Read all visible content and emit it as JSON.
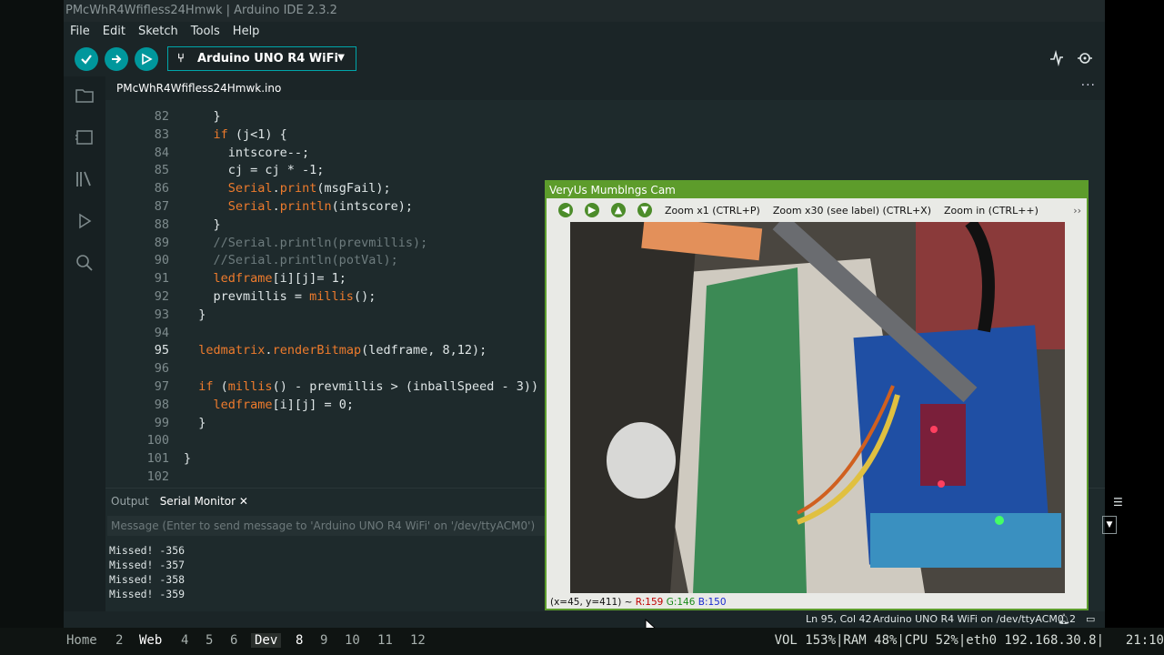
{
  "window": {
    "title": "PMcWhR4Wfifless24Hmwk | Arduino IDE 2.3.2"
  },
  "menu": [
    "File",
    "Edit",
    "Sketch",
    "Tools",
    "Help"
  ],
  "toolbar": {
    "board": "Arduino UNO R4 WiFi"
  },
  "tab": {
    "filename": "PMcWhR4Wfifless24Hmwk.ino",
    "more": "···"
  },
  "editor": {
    "lines": [
      {
        "n": "82",
        "html": "    }"
      },
      {
        "n": "83",
        "html": "    <span class=\"kw\">if</span> (j&lt;1) {"
      },
      {
        "n": "84",
        "html": "      intscore--;"
      },
      {
        "n": "85",
        "html": "      cj = cj * -1;"
      },
      {
        "n": "86",
        "html": "      <span class=\"kw\">Serial</span>.<span class=\"kw\">print</span>(msgFail);"
      },
      {
        "n": "87",
        "html": "      <span class=\"kw\">Serial</span>.<span class=\"kw\">println</span>(intscore);"
      },
      {
        "n": "88",
        "html": "    }"
      },
      {
        "n": "89",
        "html": "    <span class=\"cm\">//Serial.println(prevmillis);</span>"
      },
      {
        "n": "90",
        "html": "    <span class=\"cm\">//Serial.println(potVal);</span>"
      },
      {
        "n": "91",
        "html": "    <span class=\"kw\">ledframe</span>[i][j]= 1;"
      },
      {
        "n": "92",
        "html": "    prevmillis = <span class=\"kw\">millis</span>();"
      },
      {
        "n": "93",
        "html": "  }"
      },
      {
        "n": "94",
        "html": ""
      },
      {
        "n": "95",
        "html": "  <span class=\"kw\">ledmatrix</span>.<span class=\"kw\">renderBitmap</span>(ledframe, 8,12);"
      },
      {
        "n": "96",
        "html": ""
      },
      {
        "n": "97",
        "html": "  <span class=\"kw\">if</span> (<span class=\"kw\">millis</span>() - prevmillis &gt; (inballSpeed - 3))"
      },
      {
        "n": "98",
        "html": "    <span class=\"kw\">ledframe</span>[i][j] = 0;"
      },
      {
        "n": "99",
        "html": "  }"
      },
      {
        "n": "100",
        "html": ""
      },
      {
        "n": "101",
        "html": "}"
      },
      {
        "n": "102",
        "html": ""
      }
    ]
  },
  "panel": {
    "tabs": [
      "Output",
      "Serial Monitor"
    ],
    "input_placeholder": "Message (Enter to send message to 'Arduino UNO R4 WiFi' on '/dev/ttyACM0')",
    "serial": [
      "Missed! -356",
      "Missed! -357",
      "Missed! -358",
      "Missed! -359"
    ]
  },
  "status": {
    "position": "Ln 95, Col 42",
    "board": "Arduino UNO R4 WiFi on /dev/ttyACM0",
    "notif": "2"
  },
  "cam": {
    "title": "VeryUs Mumblngs Cam",
    "zoom1": "Zoom x1 (CTRL+P)",
    "zoom30": "Zoom x30 (see label) (CTRL+X)",
    "zoomin": "Zoom in (CTRL++)",
    "more": "››",
    "coord": "(x=45, y=411) ~ ",
    "r": "R:159",
    "g": "G:146",
    "b": "B:150"
  },
  "taskbar": {
    "workspaces": [
      "Home",
      "2",
      "Web",
      "4",
      "5",
      "6",
      "Dev",
      "8",
      "9",
      "10",
      "11",
      "12"
    ],
    "sysinfo": "VOL 153%|RAM 48%|CPU 52%|eth0 192.168.30.8|",
    "clock": "21:10"
  }
}
